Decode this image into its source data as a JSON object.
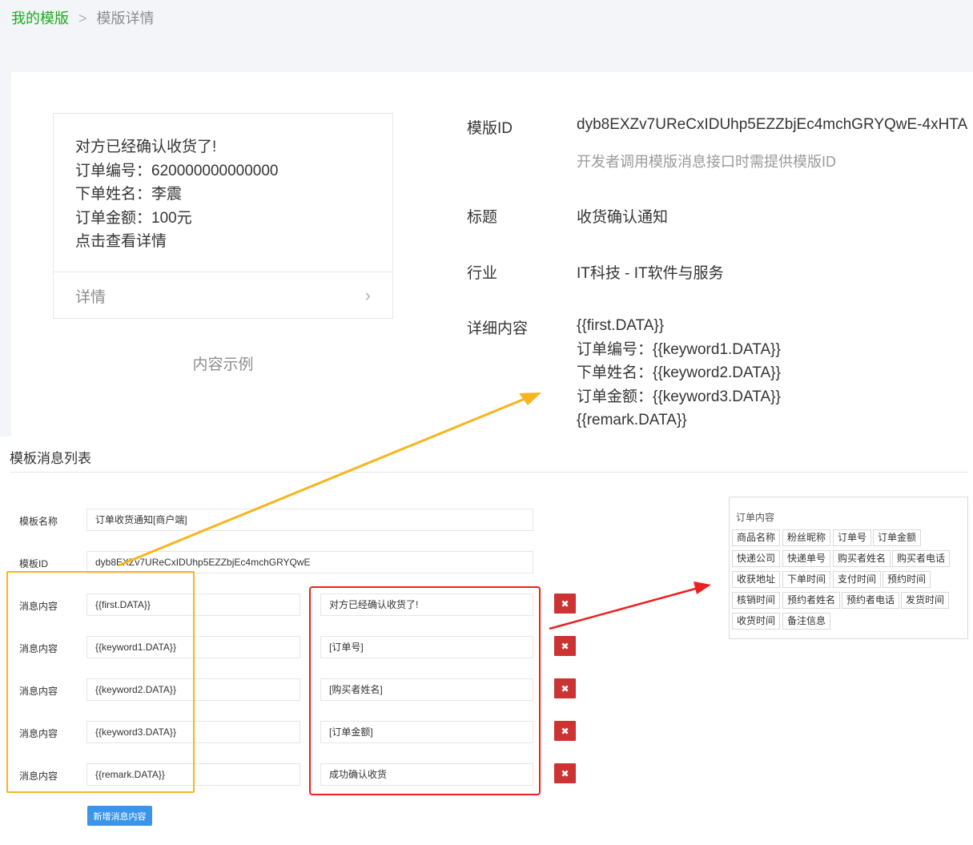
{
  "breadcrumb": {
    "parent": "我的模版",
    "separator": ">",
    "current": "模版详情"
  },
  "preview": {
    "lines": [
      "对方已经确认收货了!",
      "订单编号：620000000000000",
      "下单姓名：李震",
      "订单金额：100元",
      "点击查看详情"
    ],
    "footer_label": "详情",
    "footer_arrow": "›",
    "caption": "内容示例"
  },
  "info": {
    "template_id_label": "模版ID",
    "template_id_value": "dyb8EXZv7UReCxIDUhp5EZZbjEc4mchGRYQwE-4xHTA",
    "template_id_tip": "开发者调用模版消息接口时需提供模版ID",
    "title_label": "标题",
    "title_value": "收货确认通知",
    "industry_label": "行业",
    "industry_value": "IT科技 - IT软件与服务",
    "detail_label": "详细内容",
    "detail_lines": [
      "{{first.DATA}}",
      "订单编号：{{keyword1.DATA}}",
      "下单姓名：{{keyword2.DATA}}",
      "订单金额：{{keyword3.DATA}}",
      "{{remark.DATA}}"
    ]
  },
  "list": {
    "section_title": "模板消息列表",
    "name_label": "模板名称",
    "name_value": "订单收货通知[商户端]",
    "id_label": "模板ID",
    "id_value": "dyb8EXZv7UReCxIDUhp5EZZbjEc4mchGRYQwE",
    "rows": [
      {
        "label": "消息内容",
        "key": "{{first.DATA}}",
        "value": "对方已经确认收货了!"
      },
      {
        "label": "消息内容",
        "key": "{{keyword1.DATA}}",
        "value": "[订单号]"
      },
      {
        "label": "消息内容",
        "key": "{{keyword2.DATA}}",
        "value": "[购买者姓名]"
      },
      {
        "label": "消息内容",
        "key": "{{keyword3.DATA}}",
        "value": "[订单金额]"
      },
      {
        "label": "消息内容",
        "key": "{{remark.DATA}}",
        "value": "成功确认收货"
      }
    ],
    "delete_glyph": "✖",
    "add_button": "新增消息内容"
  },
  "tags": {
    "title": "订单内容",
    "items": [
      "商品名称",
      "粉丝昵称",
      "订单号",
      "订单金额",
      "快递公司",
      "快递单号",
      "购买者姓名",
      "购买者电话",
      "收获地址",
      "下单时间",
      "支付时间",
      "预约时间",
      "核销时间",
      "预约者姓名",
      "预约者电话",
      "发货时间",
      "收货时间",
      "备注信息"
    ]
  },
  "colors": {
    "brand_green": "#1aad19",
    "highlight_yellow": "#f7b51e",
    "highlight_red": "#ee1f1f",
    "delete_red": "#cc3333",
    "button_blue": "#3a95ea"
  }
}
